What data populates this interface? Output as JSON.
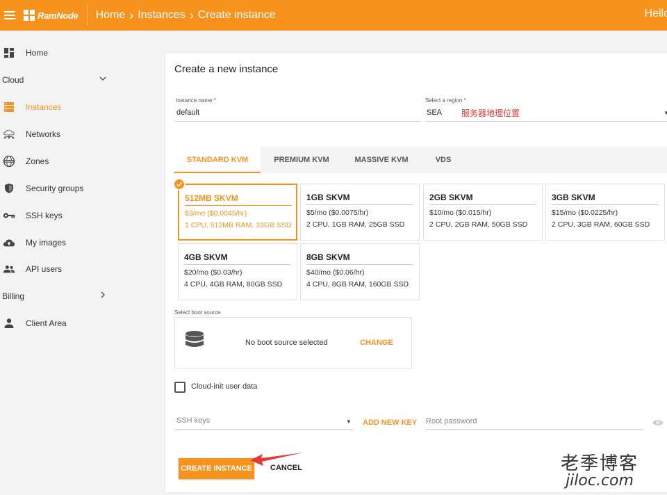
{
  "header": {
    "logo_text": "RamNode",
    "breadcrumb": [
      "Home",
      "Instances",
      "Create instance"
    ],
    "greeting": "Hello"
  },
  "sidebar": {
    "items": [
      {
        "label": "Home",
        "icon": "dashboard-icon"
      },
      {
        "label": "Cloud",
        "icon": "chevron-down-icon",
        "section": true
      },
      {
        "label": "Instances",
        "icon": "server-icon",
        "active": true
      },
      {
        "label": "Networks",
        "icon": "network-icon"
      },
      {
        "label": "Zones",
        "icon": "globe-icon"
      },
      {
        "label": "Security groups",
        "icon": "shield-icon"
      },
      {
        "label": "SSH keys",
        "icon": "key-icon"
      },
      {
        "label": "My images",
        "icon": "cloud-upload-icon"
      },
      {
        "label": "API users",
        "icon": "users-icon"
      },
      {
        "label": "Billing",
        "icon": "chevron-right-icon",
        "section": true
      },
      {
        "label": "Client Area",
        "icon": "person-icon"
      }
    ]
  },
  "form": {
    "title": "Create a new instance",
    "instance_name_label": "Instance name *",
    "instance_name_value": "default",
    "region_label": "Select a region *",
    "region_value": "SEA",
    "region_note": "服务器地理位置",
    "tabs": [
      "STANDARD KVM",
      "PREMIUM KVM",
      "MASSIVE KVM",
      "VDS"
    ],
    "plans": [
      {
        "name": "512MB SKVM",
        "price": "$3/mo ($0.0045/hr)",
        "spec": "1 CPU, 512MB RAM, 10GB SSD",
        "selected": true
      },
      {
        "name": "1GB SKVM",
        "price": "$5/mo ($0.0075/hr)",
        "spec": "2 CPU, 1GB RAM, 25GB SSD"
      },
      {
        "name": "2GB SKVM",
        "price": "$10/mo ($0.015/hr)",
        "spec": "2 CPU, 2GB RAM, 50GB SSD"
      },
      {
        "name": "3GB SKVM",
        "price": "$15/mo ($0.0225/hr)",
        "spec": "2 CPU, 3GB RAM, 60GB SSD"
      },
      {
        "name": "4GB SKVM",
        "price": "$20/mo ($0.03/hr)",
        "spec": "4 CPU, 4GB RAM, 80GB SSD"
      },
      {
        "name": "8GB SKVM",
        "price": "$40/mo ($0.06/hr)",
        "spec": "4 CPU, 8GB RAM, 160GB SSD"
      }
    ],
    "boot_label": "Select boot source",
    "boot_text": "No boot source selected",
    "boot_change": "CHANGE",
    "cloud_init_label": "Cloud-init user data",
    "ssh_keys_placeholder": "SSH keys",
    "add_new_key": "ADD NEW KEY",
    "root_password_placeholder": "Root password",
    "create_button": "CREATE INSTANCE",
    "cancel_button": "CANCEL"
  },
  "watermark": {
    "cn": "老季博客",
    "en": "jiloc.com"
  },
  "colors": {
    "accent": "#f7931d",
    "annotation": "#e53935"
  }
}
